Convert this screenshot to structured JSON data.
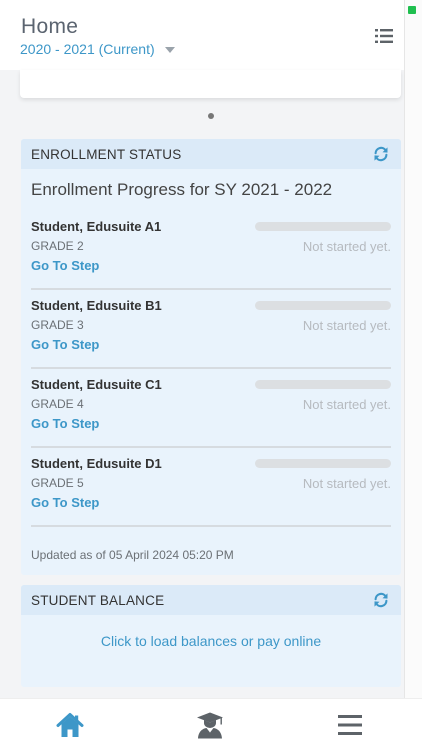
{
  "header": {
    "title": "Home",
    "school_year": "2020 - 2021 (Current)"
  },
  "enrollment": {
    "heading": "ENROLLMENT STATUS",
    "title": "Enrollment Progress for SY 2021 - 2022",
    "students": [
      {
        "name": "Student, Edusuite A1",
        "grade": "GRADE 2",
        "action": "Go To Step",
        "status": "Not started yet.",
        "progress": 0
      },
      {
        "name": "Student, Edusuite B1",
        "grade": "GRADE 3",
        "action": "Go To Step",
        "status": "Not started yet.",
        "progress": 0
      },
      {
        "name": "Student, Edusuite C1",
        "grade": "GRADE 4",
        "action": "Go To Step",
        "status": "Not started yet.",
        "progress": 0
      },
      {
        "name": "Student, Edusuite D1",
        "grade": "GRADE 5",
        "action": "Go To Step",
        "status": "Not started yet.",
        "progress": 0
      }
    ],
    "updated": "Updated as of 05 April 2024 05:20 PM"
  },
  "balance": {
    "heading": "STUDENT BALANCE",
    "link": "Click to load balances or pay online"
  },
  "icons": {
    "menu": "list-icon",
    "refresh": "refresh-icon",
    "home": "home-icon",
    "student": "graduate-icon",
    "more": "hamburger-icon"
  },
  "colors": {
    "accent": "#3d97c8",
    "panel": "#e9f3fc",
    "panel_head": "#dbeaf8",
    "nav_inactive": "#5d6368"
  }
}
